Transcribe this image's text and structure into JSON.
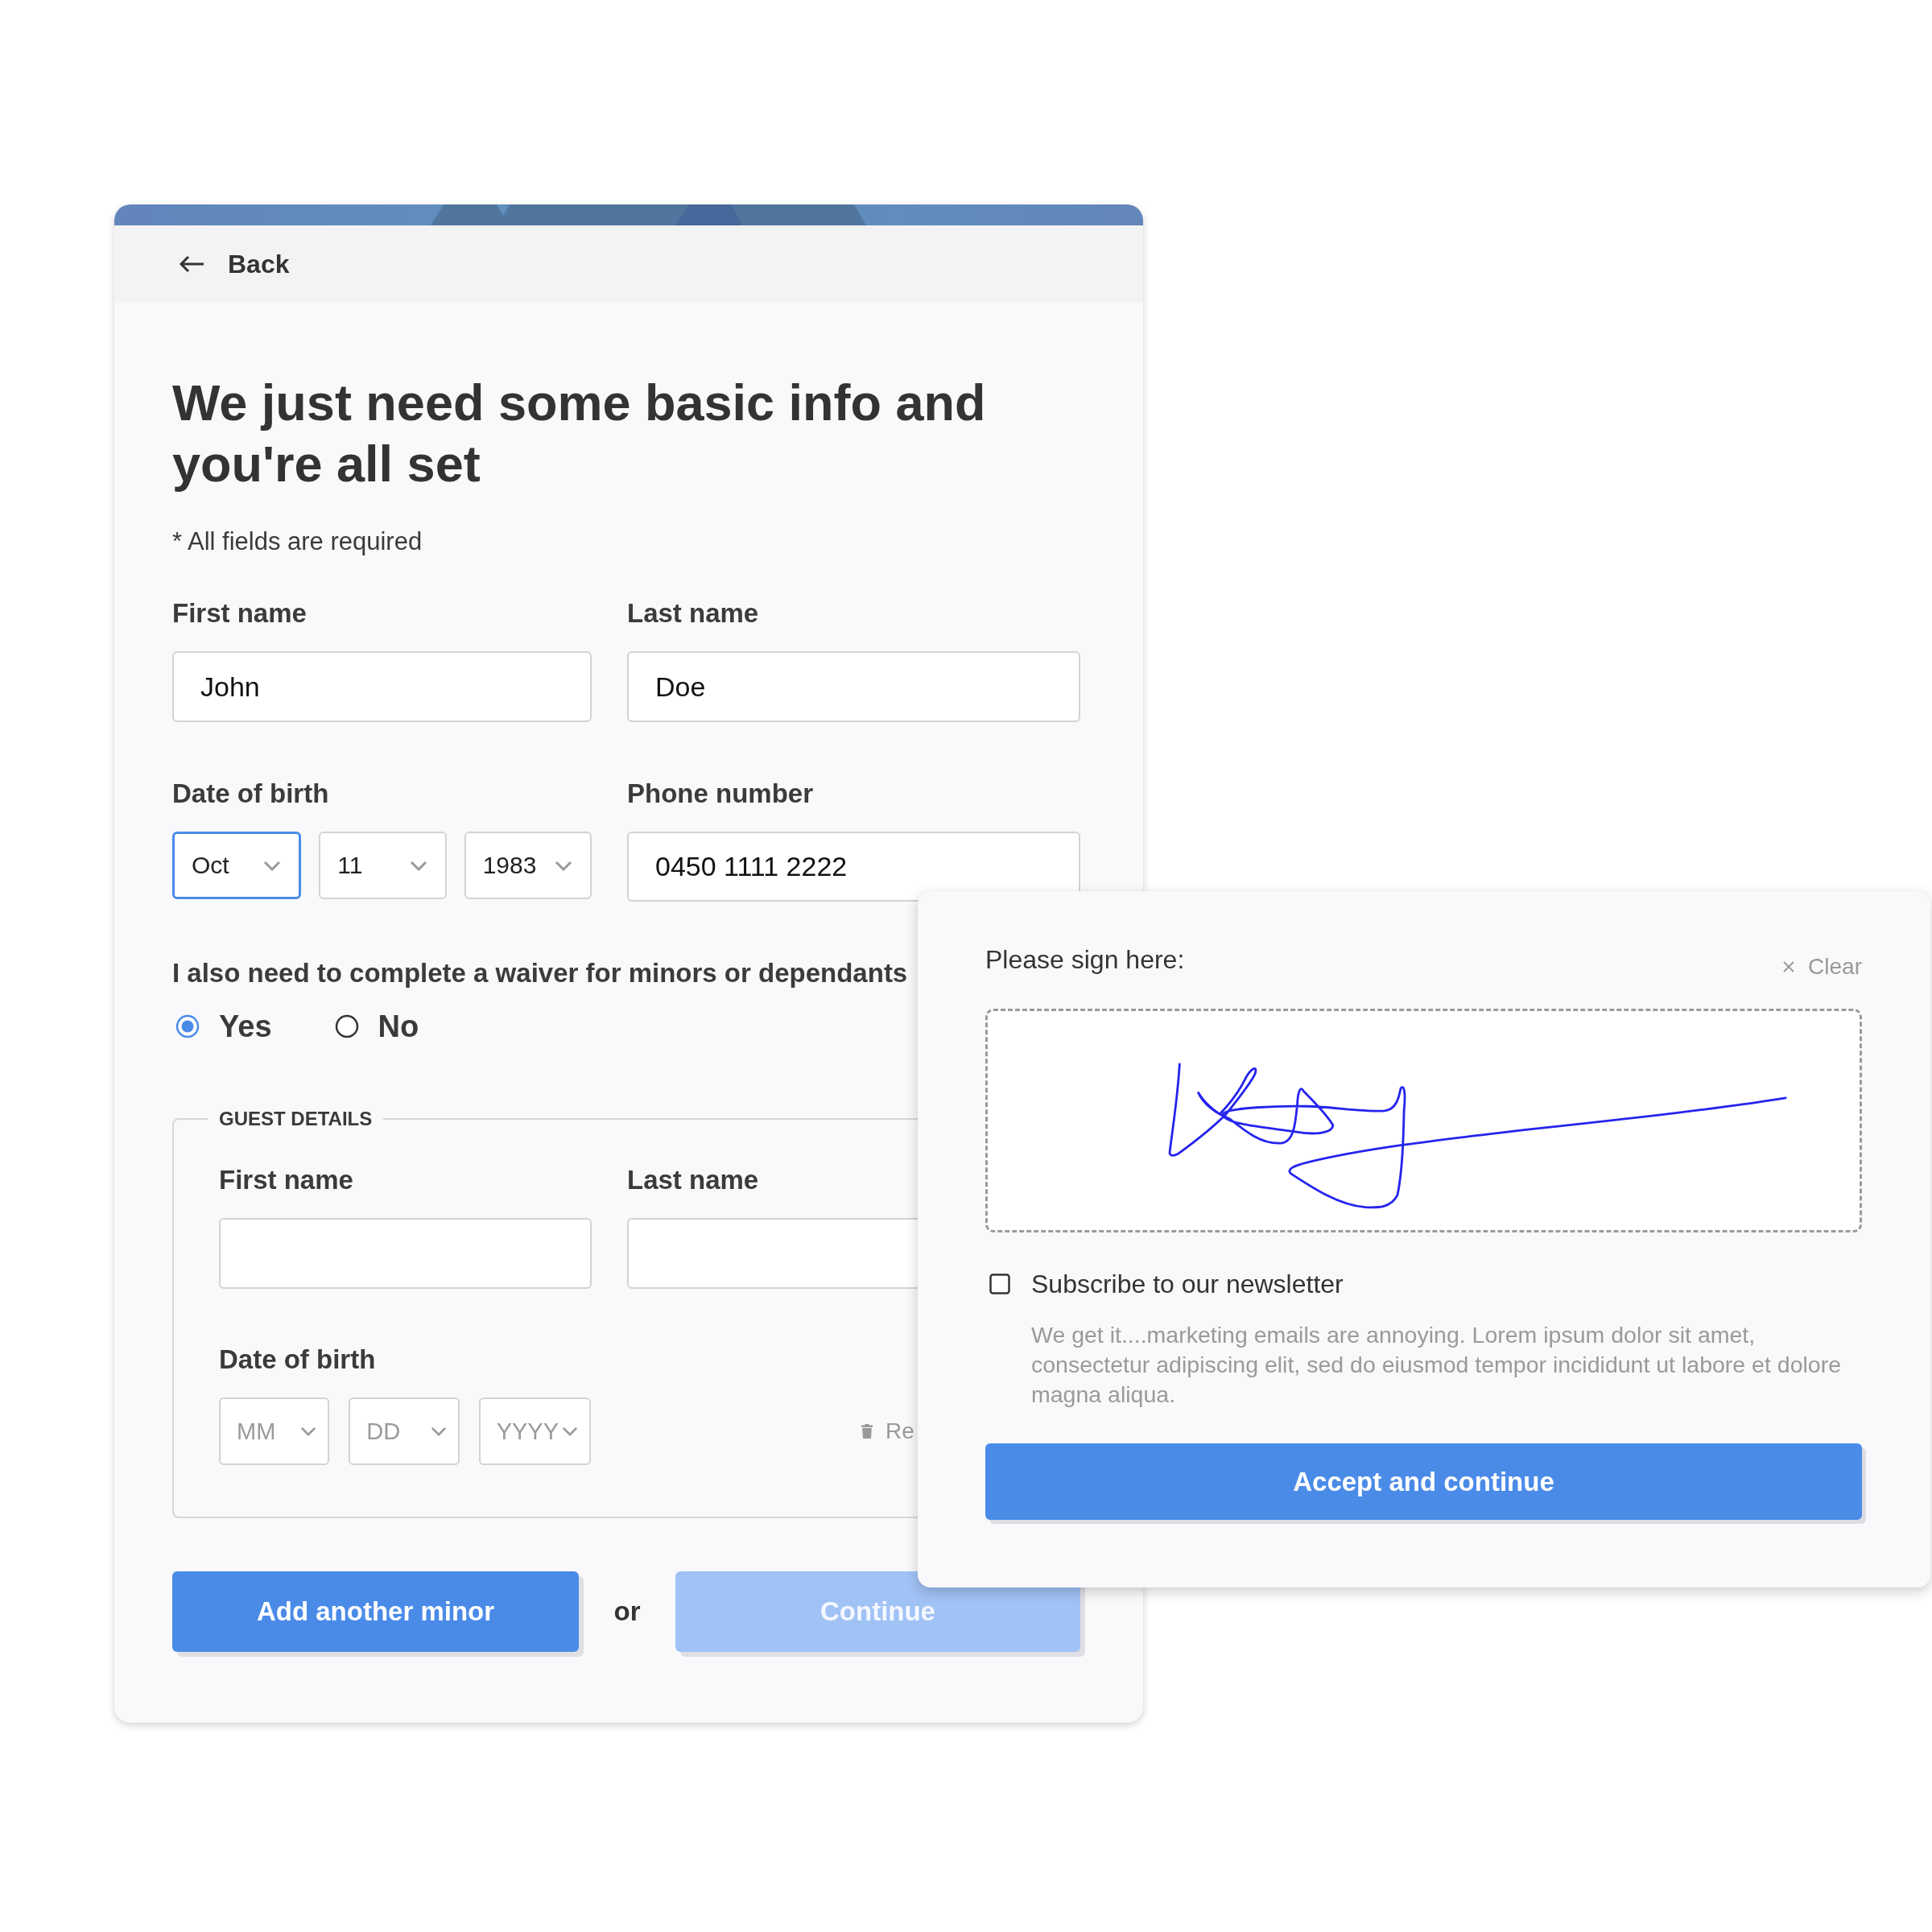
{
  "back_link": {
    "label": "Back"
  },
  "heading": "We just need some basic info and you're all set",
  "required_note": "* All fields are required",
  "name_fields": [
    {
      "label": "First name",
      "value": "John"
    },
    {
      "label": "Last name",
      "value": "Doe"
    }
  ],
  "date_of_birth": {
    "label": "Date of birth",
    "selects": [
      {
        "value": "Oct",
        "focused": true
      },
      {
        "value": "11",
        "focused": false
      },
      {
        "value": "1983",
        "focused": false
      }
    ]
  },
  "phone": {
    "label": "Phone number",
    "value": "0450 1111 2222"
  },
  "waiver": {
    "question": "I also need to complete a waiver for minors or dependants",
    "options": [
      {
        "label": "Yes",
        "selected": true
      },
      {
        "label": "No",
        "selected": false
      }
    ]
  },
  "guest_details": {
    "legend": "GUEST DETAILS",
    "name_fields": [
      {
        "label": "First name"
      },
      {
        "label": "Last name"
      }
    ],
    "date_of_birth": {
      "label": "Date of birth",
      "selects": [
        {
          "placeholder": "MM"
        },
        {
          "placeholder": "DD"
        },
        {
          "placeholder": "YYYY"
        }
      ]
    },
    "remove": {
      "label": "Re"
    }
  },
  "actions": {
    "buttons": [
      {
        "label": "Add another minor",
        "disabled": false
      },
      {
        "label": "Continue",
        "disabled": true
      }
    ],
    "separator": "or"
  },
  "signature_panel": {
    "prompt": "Please sign here:",
    "clear": {
      "label": "Clear"
    },
    "newsletter": {
      "label": "Subscribe to our newsletter",
      "checked": false,
      "description": "We get it....marketing emails are annoying. Lorem ipsum dolor sit amet, consectetur adipiscing elit, sed do eiusmod tempor incididunt ut labore et dolore magna aliqua."
    },
    "submit": {
      "label": "Accept and continue"
    }
  }
}
